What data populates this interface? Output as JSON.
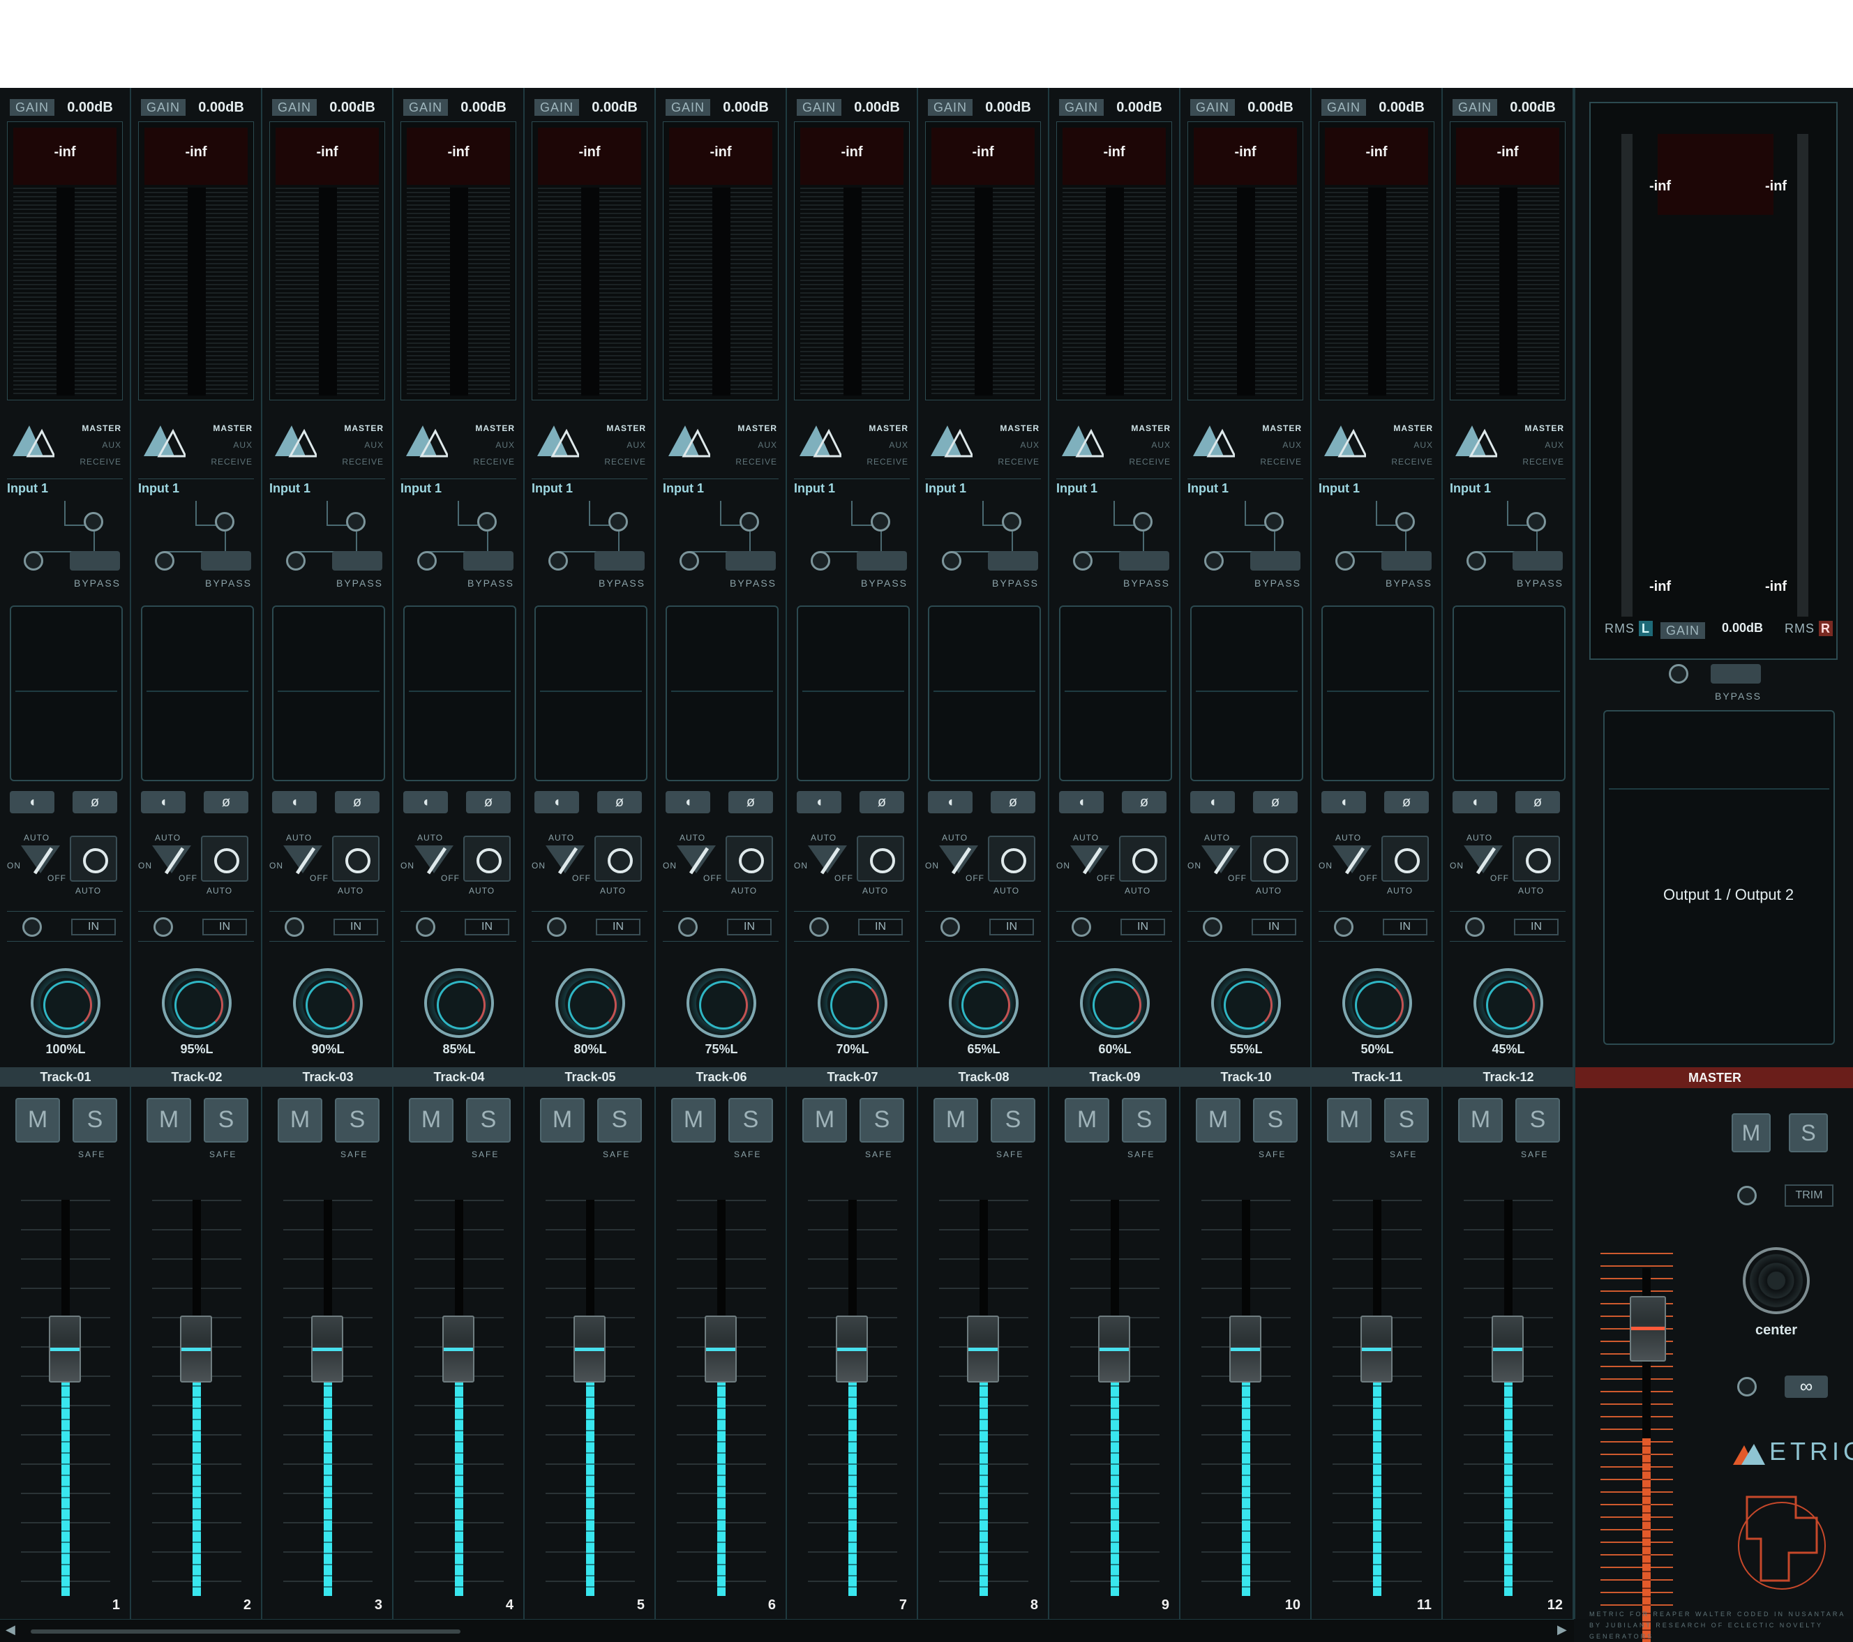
{
  "tracks": [
    {
      "gain": "GAIN",
      "gain_value": "0.00dB",
      "peak": "-inf",
      "route": {
        "master": "MASTER",
        "aux": "AUX",
        "receive": "RECEIVE"
      },
      "input": "Input 1",
      "bypass": "BYPASS",
      "auto": "AUTO",
      "on": "ON",
      "off": "OFF",
      "auto2": "AUTO",
      "in": "IN",
      "pan": "100%L",
      "name": "Track-01",
      "mute": "M",
      "solo": "S",
      "safe": "SAFE",
      "number": "1"
    },
    {
      "gain": "GAIN",
      "gain_value": "0.00dB",
      "peak": "-inf",
      "route": {
        "master": "MASTER",
        "aux": "AUX",
        "receive": "RECEIVE"
      },
      "input": "Input 1",
      "bypass": "BYPASS",
      "auto": "AUTO",
      "on": "ON",
      "off": "OFF",
      "auto2": "AUTO",
      "in": "IN",
      "pan": "95%L",
      "name": "Track-02",
      "mute": "M",
      "solo": "S",
      "safe": "SAFE",
      "number": "2"
    },
    {
      "gain": "GAIN",
      "gain_value": "0.00dB",
      "peak": "-inf",
      "route": {
        "master": "MASTER",
        "aux": "AUX",
        "receive": "RECEIVE"
      },
      "input": "Input 1",
      "bypass": "BYPASS",
      "auto": "AUTO",
      "on": "ON",
      "off": "OFF",
      "auto2": "AUTO",
      "in": "IN",
      "pan": "90%L",
      "name": "Track-03",
      "mute": "M",
      "solo": "S",
      "safe": "SAFE",
      "number": "3"
    },
    {
      "gain": "GAIN",
      "gain_value": "0.00dB",
      "peak": "-inf",
      "route": {
        "master": "MASTER",
        "aux": "AUX",
        "receive": "RECEIVE"
      },
      "input": "Input 1",
      "bypass": "BYPASS",
      "auto": "AUTO",
      "on": "ON",
      "off": "OFF",
      "auto2": "AUTO",
      "in": "IN",
      "pan": "85%L",
      "name": "Track-04",
      "mute": "M",
      "solo": "S",
      "safe": "SAFE",
      "number": "4"
    },
    {
      "gain": "GAIN",
      "gain_value": "0.00dB",
      "peak": "-inf",
      "route": {
        "master": "MASTER",
        "aux": "AUX",
        "receive": "RECEIVE"
      },
      "input": "Input 1",
      "bypass": "BYPASS",
      "auto": "AUTO",
      "on": "ON",
      "off": "OFF",
      "auto2": "AUTO",
      "in": "IN",
      "pan": "80%L",
      "name": "Track-05",
      "mute": "M",
      "solo": "S",
      "safe": "SAFE",
      "number": "5"
    },
    {
      "gain": "GAIN",
      "gain_value": "0.00dB",
      "peak": "-inf",
      "route": {
        "master": "MASTER",
        "aux": "AUX",
        "receive": "RECEIVE"
      },
      "input": "Input 1",
      "bypass": "BYPASS",
      "auto": "AUTO",
      "on": "ON",
      "off": "OFF",
      "auto2": "AUTO",
      "in": "IN",
      "pan": "75%L",
      "name": "Track-06",
      "mute": "M",
      "solo": "S",
      "safe": "SAFE",
      "number": "6"
    },
    {
      "gain": "GAIN",
      "gain_value": "0.00dB",
      "peak": "-inf",
      "route": {
        "master": "MASTER",
        "aux": "AUX",
        "receive": "RECEIVE"
      },
      "input": "Input 1",
      "bypass": "BYPASS",
      "auto": "AUTO",
      "on": "ON",
      "off": "OFF",
      "auto2": "AUTO",
      "in": "IN",
      "pan": "70%L",
      "name": "Track-07",
      "mute": "M",
      "solo": "S",
      "safe": "SAFE",
      "number": "7"
    },
    {
      "gain": "GAIN",
      "gain_value": "0.00dB",
      "peak": "-inf",
      "route": {
        "master": "MASTER",
        "aux": "AUX",
        "receive": "RECEIVE"
      },
      "input": "Input 1",
      "bypass": "BYPASS",
      "auto": "AUTO",
      "on": "ON",
      "off": "OFF",
      "auto2": "AUTO",
      "in": "IN",
      "pan": "65%L",
      "name": "Track-08",
      "mute": "M",
      "solo": "S",
      "safe": "SAFE",
      "number": "8"
    },
    {
      "gain": "GAIN",
      "gain_value": "0.00dB",
      "peak": "-inf",
      "route": {
        "master": "MASTER",
        "aux": "AUX",
        "receive": "RECEIVE"
      },
      "input": "Input 1",
      "bypass": "BYPASS",
      "auto": "AUTO",
      "on": "ON",
      "off": "OFF",
      "auto2": "AUTO",
      "in": "IN",
      "pan": "60%L",
      "name": "Track-09",
      "mute": "M",
      "solo": "S",
      "safe": "SAFE",
      "number": "9"
    },
    {
      "gain": "GAIN",
      "gain_value": "0.00dB",
      "peak": "-inf",
      "route": {
        "master": "MASTER",
        "aux": "AUX",
        "receive": "RECEIVE"
      },
      "input": "Input 1",
      "bypass": "BYPASS",
      "auto": "AUTO",
      "on": "ON",
      "off": "OFF",
      "auto2": "AUTO",
      "in": "IN",
      "pan": "55%L",
      "name": "Track-10",
      "mute": "M",
      "solo": "S",
      "safe": "SAFE",
      "number": "10"
    },
    {
      "gain": "GAIN",
      "gain_value": "0.00dB",
      "peak": "-inf",
      "route": {
        "master": "MASTER",
        "aux": "AUX",
        "receive": "RECEIVE"
      },
      "input": "Input 1",
      "bypass": "BYPASS",
      "auto": "AUTO",
      "on": "ON",
      "off": "OFF",
      "auto2": "AUTO",
      "in": "IN",
      "pan": "50%L",
      "name": "Track-11",
      "mute": "M",
      "solo": "S",
      "safe": "SAFE",
      "number": "11"
    },
    {
      "gain": "GAIN",
      "gain_value": "0.00dB",
      "peak": "-inf",
      "route": {
        "master": "MASTER",
        "aux": "AUX",
        "receive": "RECEIVE"
      },
      "input": "Input 1",
      "bypass": "BYPASS",
      "auto": "AUTO",
      "on": "ON",
      "off": "OFF",
      "auto2": "AUTO",
      "in": "IN",
      "pan": "45%L",
      "name": "Track-12",
      "mute": "M",
      "solo": "S",
      "safe": "SAFE",
      "number": "12"
    }
  ],
  "master": {
    "peak_l": "-inf",
    "peak_r": "-inf",
    "floor_l": "-inf",
    "floor_r": "-inf",
    "rms": "RMS",
    "left_tag": "L",
    "right_tag": "R",
    "gain": "GAIN",
    "gain_value": "0.00dB",
    "bypass": "BYPASS",
    "output": "Output 1 / Output 2",
    "name": "MASTER",
    "mute": "M",
    "solo": "S",
    "trim": "TRIM",
    "pan": "center",
    "link": "∞",
    "brand": "ETRIC",
    "credit": "METRIC FOR REAPER WALTER CODED IN NUSANTARA BY JUBILANT RESEARCH OF ECLECTIC NOVELTY GENERATORS"
  },
  "colors": {
    "accent": "#39e6ee",
    "master_accent": "#e25a2a",
    "master_name_bg": "#6a1e1a",
    "background": "#0d1113"
  },
  "scrollbar": {
    "left": "◀",
    "right": "▶"
  }
}
